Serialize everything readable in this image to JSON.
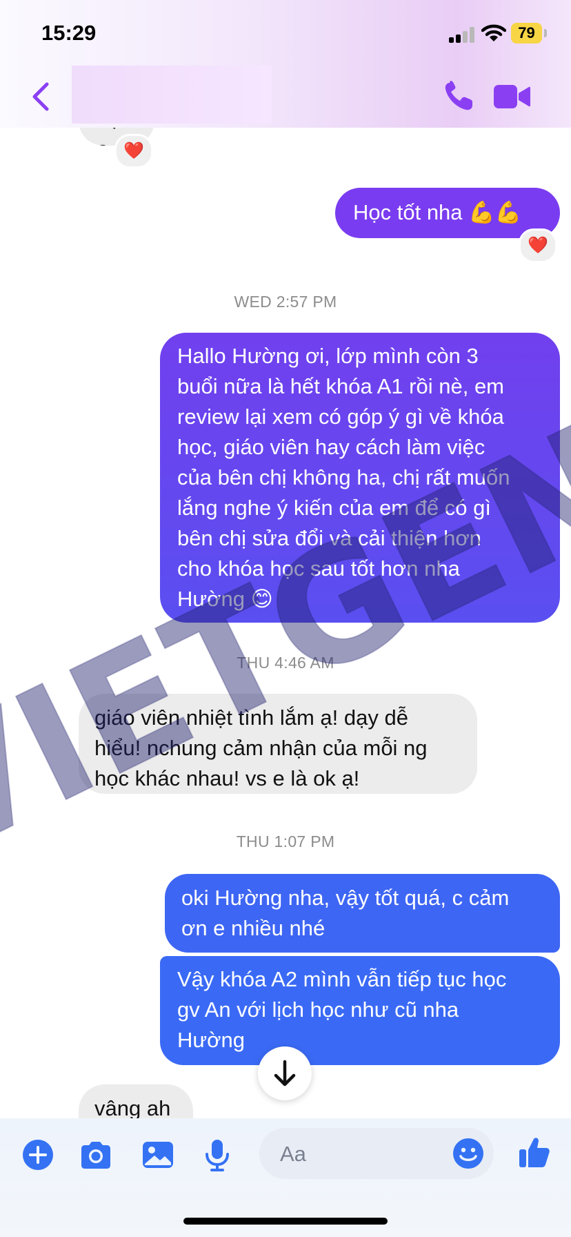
{
  "status_bar": {
    "time": "15:29",
    "battery": "79"
  },
  "header": {
    "back_icon": "chevron-left-icon",
    "phone_icon": "phone-icon",
    "video_icon": "video-camera-icon"
  },
  "colors": {
    "accent": "#8b3ff2",
    "outgoing_purple": "#7a3cf0",
    "outgoing_blue": "#3a6af5",
    "incoming": "#ececec",
    "reaction_heart": "#e0233c"
  },
  "messages": [
    {
      "type": "out",
      "text": "Học tốt nha 💪💪",
      "reaction": "❤️"
    },
    {
      "type": "timestamp",
      "text": "WED 2:57 PM"
    },
    {
      "type": "out",
      "text": "Hallo Hường ơi, lớp mình còn 3\nbuổi nữa là hết khóa A1 rồi nè, em\nreview lại xem có góp ý gì về khóa\nhọc, giáo viên hay cách làm việc\ncủa bên chị không ha, chị rất muốn\nlắng nghe ý kiến của em để có gì\nbên chị sửa đổi và cải thiện hơn\ncho khóa học sau tốt hơn nha\nHường 😊"
    },
    {
      "type": "timestamp",
      "text": "THU 4:46 AM"
    },
    {
      "type": "in",
      "text": "giáo viên nhiệt tình lắm ạ! dạy dễ\nhiểu! nchung cảm nhận của mỗi ng\nhọc khác nhau! vs e là ok ạ!"
    },
    {
      "type": "timestamp",
      "text": "THU 1:07 PM"
    },
    {
      "type": "out",
      "text": "oki Hường nha, vậy tốt quá, c cảm\nơn e nhiều nhé"
    },
    {
      "type": "out",
      "text": "Vậy khóa A2 mình vẫn tiếp tục học\ngv An với lịch học như cũ nha\nHường"
    },
    {
      "type": "in",
      "text": "vâng ah"
    }
  ],
  "partial_top_message": {
    "text": "dạ e",
    "reaction": "❤️"
  },
  "watermark": "VIETGEN",
  "composer": {
    "placeholder": "Aa",
    "icons": [
      "plus-circle-icon",
      "camera-icon",
      "image-icon",
      "microphone-icon",
      "emoji-icon",
      "thumbs-up-icon"
    ]
  }
}
